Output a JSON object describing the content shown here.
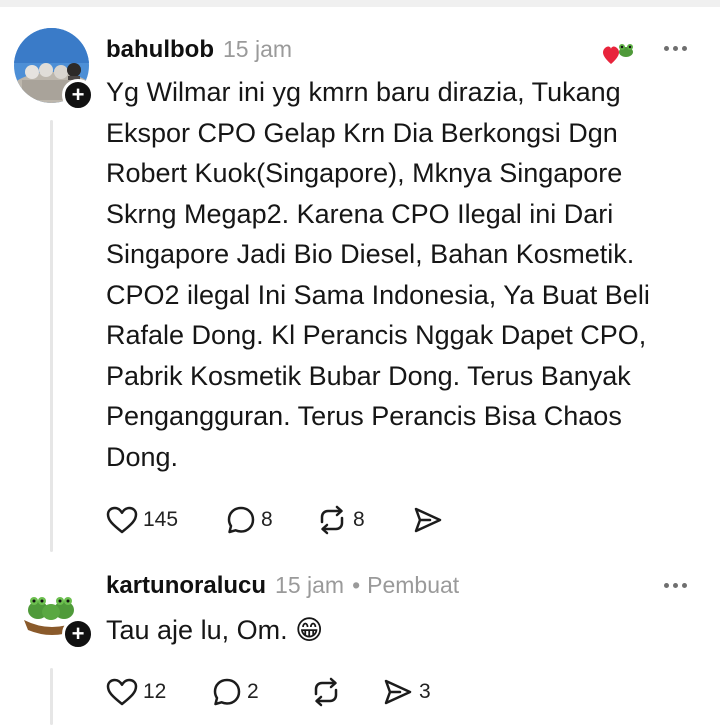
{
  "posts": [
    {
      "username": "bahulbob",
      "time": "15 jam",
      "role": "",
      "text": "Yg Wilmar ini yg kmrn baru dirazia, Tukang Ekspor CPO Gelap Krn Dia Berkongsi Dgn Robert Kuok(Singapore), Mknya Singapore Skrng Megap2. Karena CPO Ilegal ini Dari Singapore Jadi Bio Diesel, Bahan Kosmetik. CPO2 ilegal Ini Sama Indonesia, Ya Buat Beli Rafale Dong. Kl Perancis Nggak Dapet CPO, Pabrik Kosmetik Bubar Dong. Terus Banyak Pengangguran. Terus Perancis Bisa Chaos Dong.",
      "likes": "145",
      "replies": "8",
      "reposts": "8",
      "shares": ""
    },
    {
      "username": "kartunoralucu",
      "time": "15 jam",
      "role": "Pembuat",
      "text": "Tau aje lu, Om. 😁",
      "likes": "12",
      "replies": "2",
      "reposts": "",
      "shares": "3"
    }
  ],
  "ui": {
    "dot_separator": "•",
    "follow_plus": "+"
  },
  "icons": {
    "like": "heart-outline-icon",
    "reply": "comment-bubble-icon",
    "repost": "repost-arrows-icon",
    "share": "send-paper-plane-icon",
    "more": "more-dots-icon",
    "follow": "plus-icon",
    "liked_by_author": "red-heart-frog-icon"
  },
  "colors": {
    "meta_gray": "#9a9a9a",
    "heart_red": "#e8243c",
    "thread_line": "#e6e6e6"
  }
}
